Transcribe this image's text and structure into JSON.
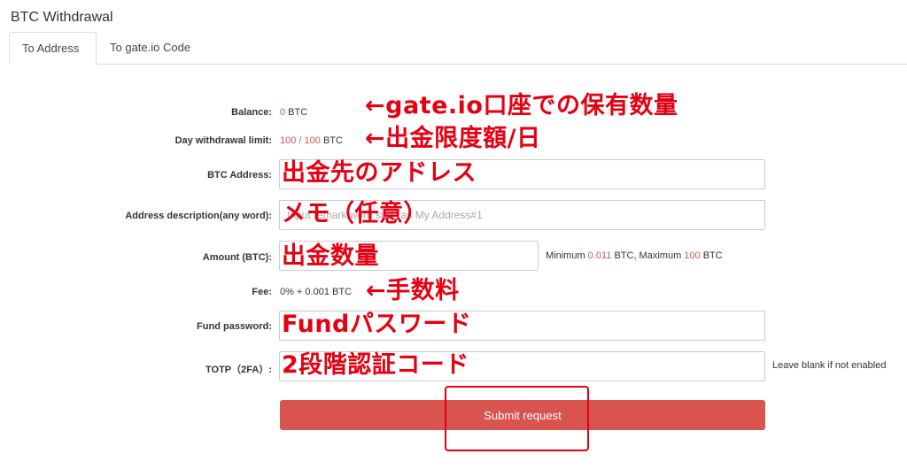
{
  "title": "BTC Withdrawal",
  "tabs": [
    {
      "label": "To Address"
    },
    {
      "label": "To gate.io Code"
    }
  ],
  "form": {
    "balance": {
      "label": "Balance:",
      "value": "0",
      "unit": " BTC"
    },
    "limit": {
      "label": "Day withdrawal limit:",
      "used": "100",
      "sep": " / ",
      "max": "100",
      "unit": " BTC"
    },
    "address": {
      "label": "BTC Address:",
      "value": "",
      "placeholder": ""
    },
    "description": {
      "label": "Address description(any word):",
      "value": "",
      "placeholder": "Input remark word such as My Address#1"
    },
    "amount": {
      "label": "Amount (BTC):",
      "value": "",
      "placeholder": "",
      "hint_pre": "Minimum ",
      "min": "0.011",
      "hint_mid": " BTC, Maximum ",
      "max": "100",
      "hint_post": " BTC"
    },
    "fee": {
      "label": "Fee:",
      "value": "0% + 0.001 BTC"
    },
    "fund_password": {
      "label": "Fund password:",
      "value": ""
    },
    "totp": {
      "label": "TOTP（2FA）:",
      "value": "",
      "hint": "Leave blank if not enabled"
    },
    "submit_label": "Submit request"
  },
  "annotations": {
    "balance": "←gate.io口座での保有数量",
    "limit": "←出金限度額/日",
    "address": "出金先のアドレス",
    "description": "メモ（任意）",
    "amount": "出金数量",
    "fee": "←手数料",
    "fund_password": "Fundパスワード",
    "totp": "2段階認証コード"
  },
  "colors": {
    "accent": "#d9534f",
    "annotation": "#e50012"
  }
}
